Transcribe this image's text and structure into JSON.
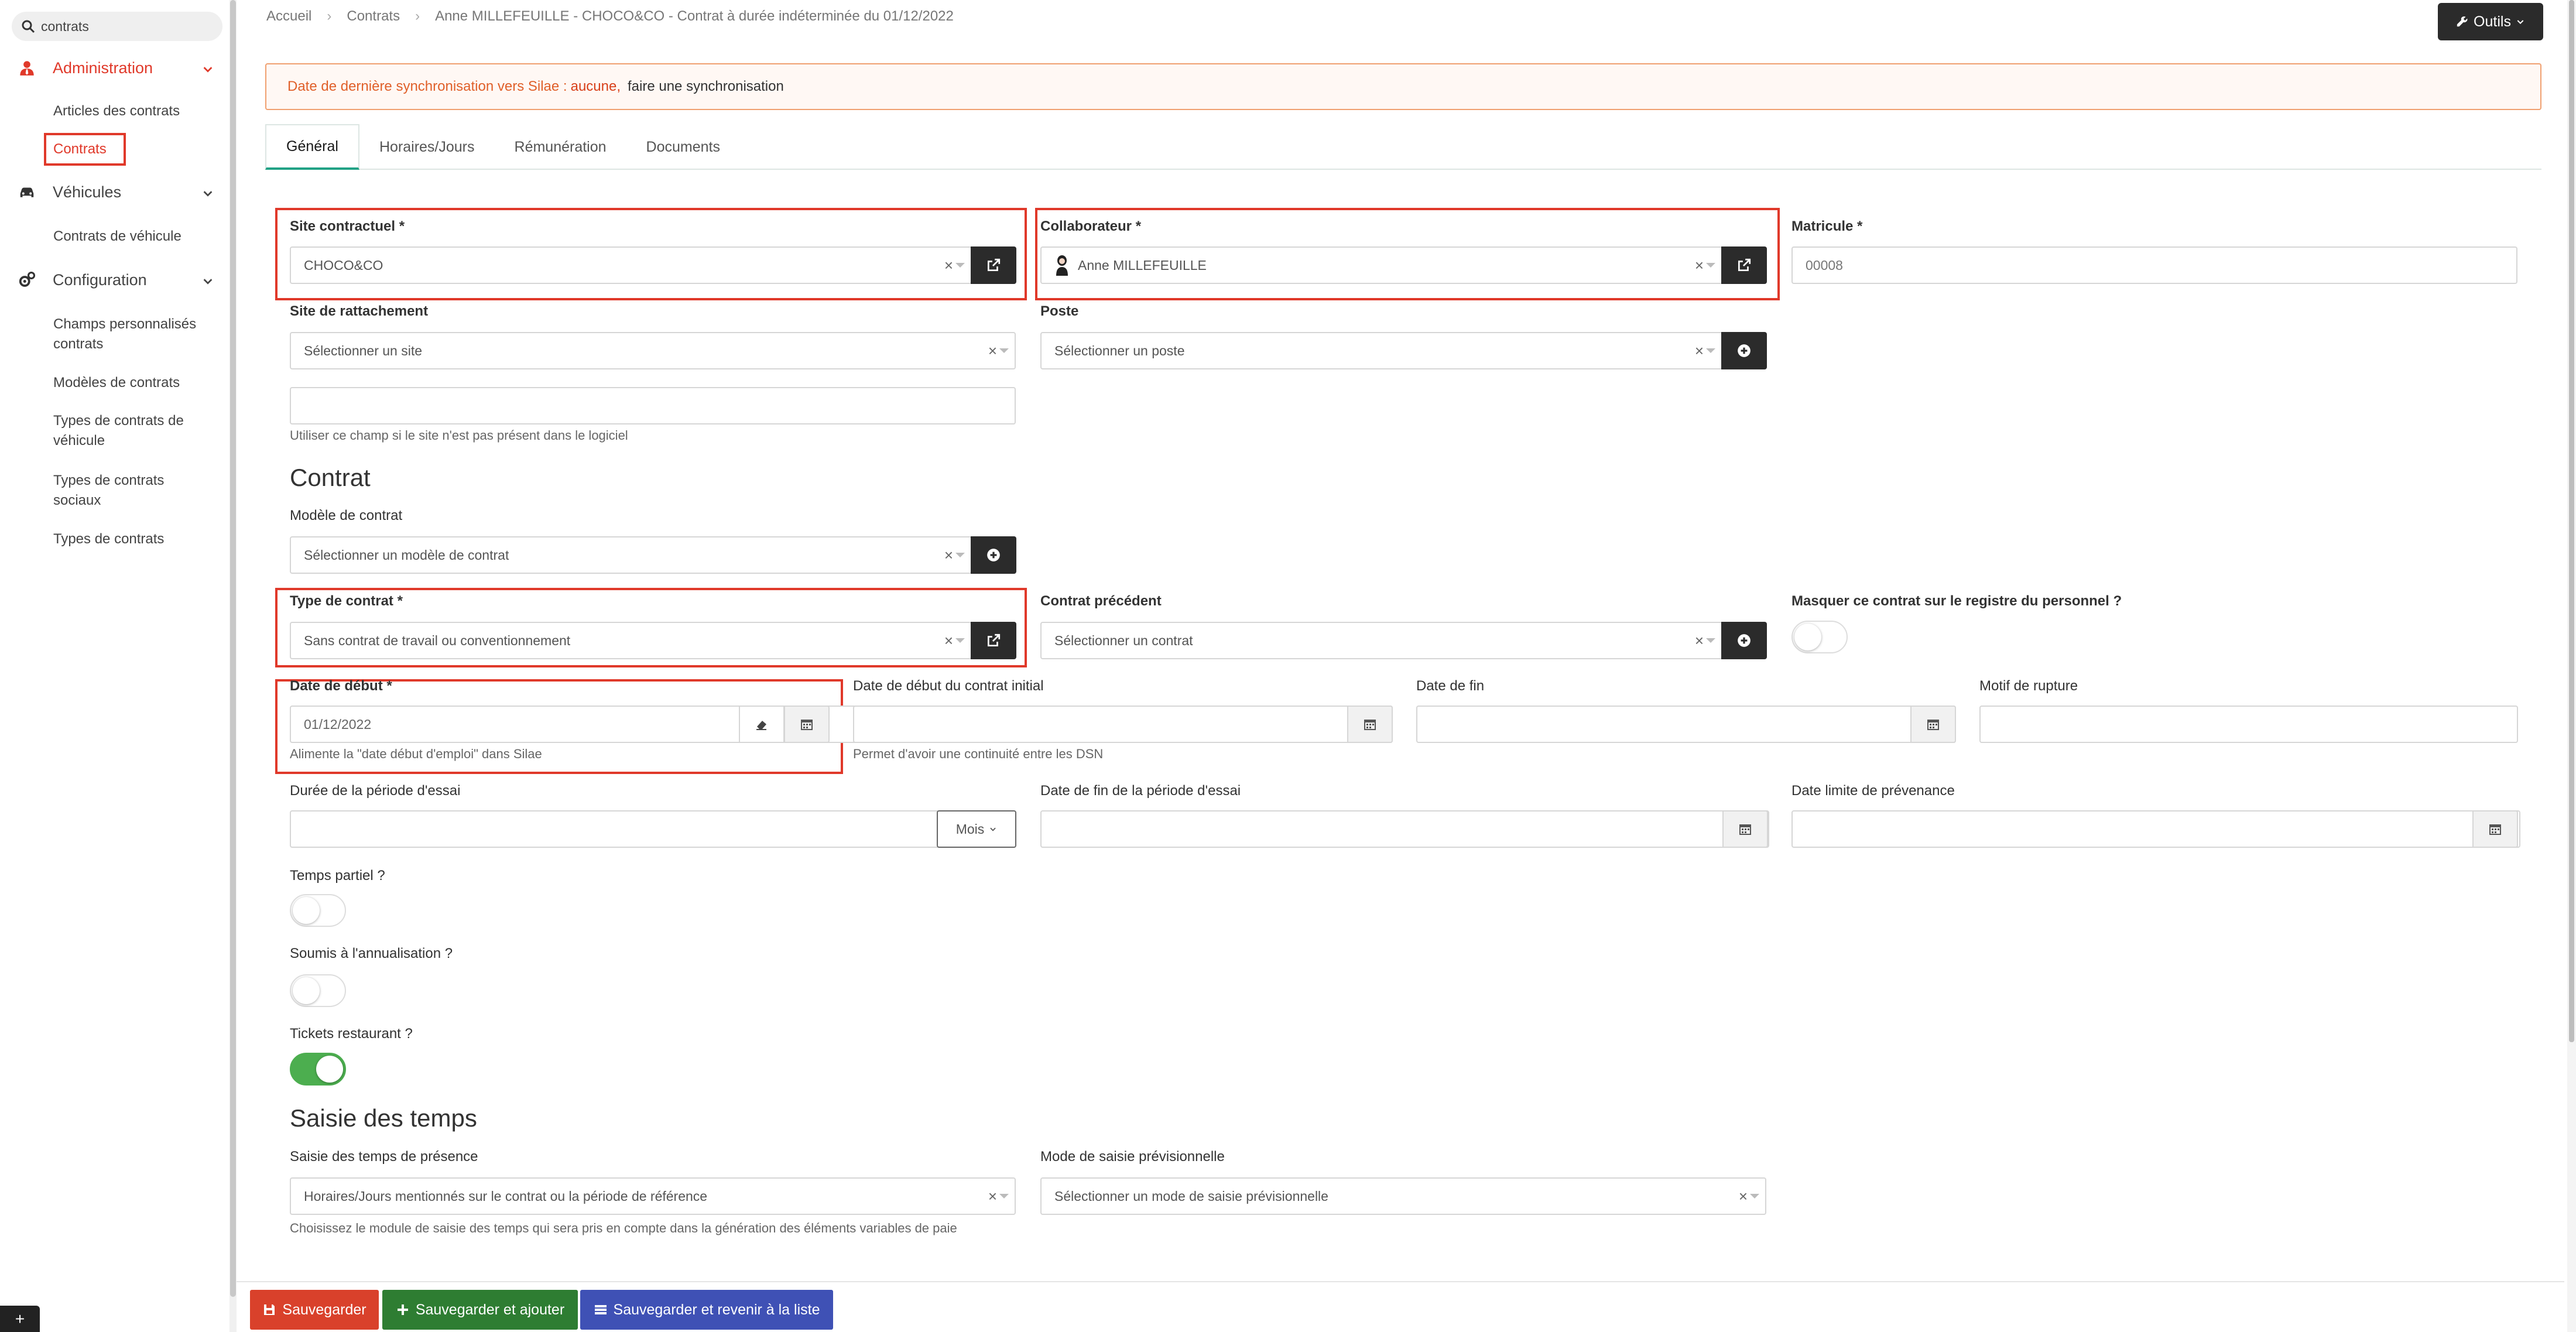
{
  "sidebar": {
    "search_value": "contrats",
    "sections": [
      {
        "label": "Administration",
        "icon": "user-tie-icon",
        "active_color": "#e0392a"
      },
      {
        "label": "Véhicules",
        "icon": "car-icon"
      },
      {
        "label": "Configuration",
        "icon": "cogs-icon"
      }
    ],
    "admin_items": [
      "Articles des contrats",
      "Contrats"
    ],
    "vehicle_items": [
      "Contrats de véhicule"
    ],
    "config_items": [
      "Champs personnalisés contrats",
      "Modèles de contrats",
      "Types de contrats de véhicule",
      "Types de contrats sociaux",
      "Types de contrats"
    ],
    "plus_label": "+"
  },
  "breadcrumb": [
    "Accueil",
    "Contrats",
    "Anne MILLEFEUILLE - CHOCO&CO - Contrat à durée indéterminée du 01/12/2022"
  ],
  "toolbar": {
    "outils_label": "Outils"
  },
  "alert": {
    "text": "Date de dernière synchronisation vers Silae :",
    "value": "aucune,",
    "link": "faire une synchronisation"
  },
  "tabs": [
    "Général",
    "Horaires/Jours",
    "Rémunération",
    "Documents"
  ],
  "form": {
    "site_contractuel": {
      "label": "Site contractuel *",
      "value": "CHOCO&CO"
    },
    "collaborateur": {
      "label": "Collaborateur *",
      "value": "Anne MILLEFEUILLE"
    },
    "matricule": {
      "label": "Matricule *",
      "value": "00008"
    },
    "site_rattachement": {
      "label": "Site de rattachement",
      "placeholder": "Sélectionner un site",
      "help": "Utiliser ce champ si le site n'est pas présent dans le logiciel"
    },
    "poste": {
      "label": "Poste",
      "placeholder": "Sélectionner un poste"
    },
    "contrat_heading": "Contrat",
    "modele": {
      "label": "Modèle de contrat",
      "placeholder": "Sélectionner un modèle de contrat"
    },
    "type_contrat": {
      "label": "Type de contrat *",
      "value": "Sans contrat de travail ou conventionnement"
    },
    "contrat_precedent": {
      "label": "Contrat précédent",
      "placeholder": "Sélectionner un contrat"
    },
    "masquer": {
      "label": "Masquer ce contrat sur le registre du personnel ?",
      "on": false
    },
    "date_debut": {
      "label": "Date de début *",
      "value": "01/12/2022",
      "help": "Alimente la \"date début d'emploi\" dans Silae"
    },
    "date_debut_initial": {
      "label": "Date de début du contrat initial",
      "help": "Permet d'avoir une continuité entre les DSN"
    },
    "date_fin": {
      "label": "Date de fin"
    },
    "motif_rupture": {
      "label": "Motif de rupture"
    },
    "duree_essai": {
      "label": "Durée de la période d'essai",
      "unit": "Mois"
    },
    "date_fin_essai": {
      "label": "Date de fin de la période d'essai"
    },
    "date_prevenance": {
      "label": "Date limite de prévenance"
    },
    "temps_partiel": {
      "label": "Temps partiel ?",
      "on": false
    },
    "annualisation": {
      "label": "Soumis à l'annualisation ?",
      "on": false
    },
    "tickets": {
      "label": "Tickets restaurant ?",
      "on": true
    },
    "saisie_heading": "Saisie des temps",
    "saisie_presence": {
      "label": "Saisie des temps de présence",
      "value": "Horaires/Jours mentionnés sur le contrat ou la période de référence",
      "help": "Choisissez le module de saisie des temps qui sera pris en compte dans la génération des éléments variables de paie"
    },
    "mode_saisie": {
      "label": "Mode de saisie prévisionnelle",
      "placeholder": "Sélectionner un mode de saisie prévisionnelle"
    }
  },
  "footer": {
    "save": "Sauvegarder",
    "save_add": "Sauvegarder et ajouter",
    "save_back": "Sauvegarder et revenir à la liste"
  },
  "colors": {
    "accent": "#e0392a",
    "tab_active": "#21a185",
    "save": "#d9412b",
    "save_add": "#2e7d32",
    "save_back": "#3f51b5",
    "toggle_on": "#4cae4f"
  }
}
